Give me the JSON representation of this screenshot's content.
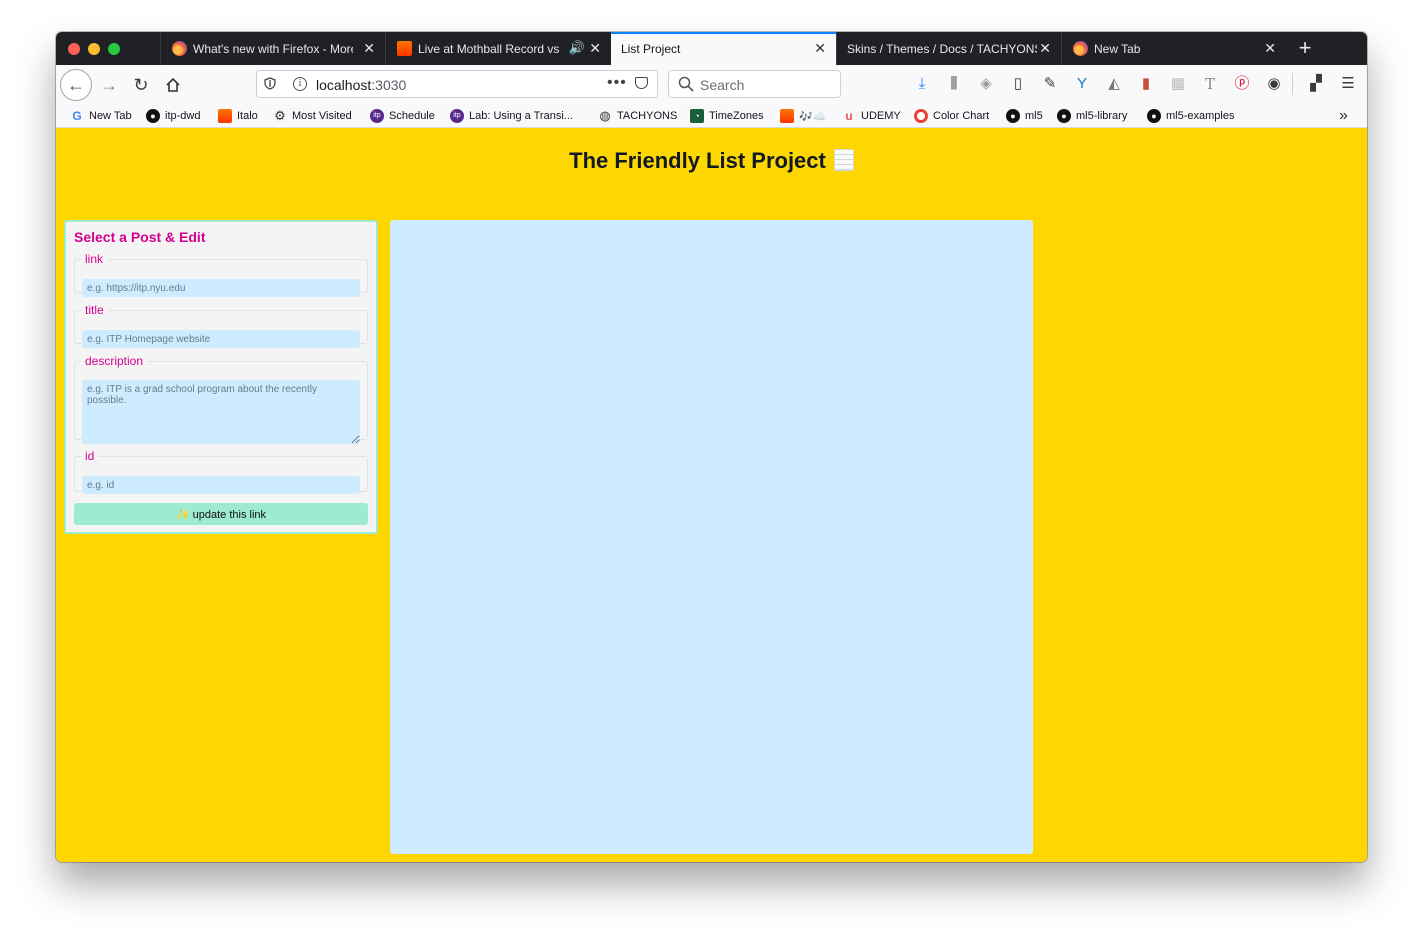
{
  "browser": {
    "tabs": [
      {
        "label": "What's new with Firefox - More",
        "icon": "firefox-icon"
      },
      {
        "label": "Live at Mothball Record vs D",
        "icon": "soundcloud-icon",
        "audio": "speaker-icon"
      },
      {
        "label": "List Project",
        "icon": ""
      },
      {
        "label": "Skins / Themes / Docs / TACHYONS",
        "icon": ""
      },
      {
        "label": "New Tab",
        "icon": "firefox-icon"
      }
    ],
    "close_glyph": "✕",
    "new_tab_glyph": "+",
    "url": {
      "host": "localhost",
      "port": ":3030"
    },
    "url_more": "•••",
    "search_placeholder": "Search",
    "bookmarks_overflow": "»",
    "bookmarks": [
      {
        "label": "New Tab",
        "icon": "google-icon"
      },
      {
        "label": "itp-dwd",
        "icon": "github-icon"
      },
      {
        "label": "Italo",
        "icon": "soundcloud-icon"
      },
      {
        "label": "Most Visited",
        "icon": "gear-icon"
      },
      {
        "label": "Schedule",
        "icon": "itp-icon"
      },
      {
        "label": "Lab: Using a Transi...",
        "icon": "itp-icon"
      },
      {
        "label": "TACHYONS",
        "icon": "globe-icon"
      },
      {
        "label": "TimeZones",
        "icon": "timezones-icon"
      },
      {
        "label": "🎶☁️",
        "icon": "soundcloud-icon"
      },
      {
        "label": "UDEMY",
        "icon": "udemy-icon"
      },
      {
        "label": "Color Chart",
        "icon": "color-chart-icon"
      },
      {
        "label": "ml5",
        "icon": "github-icon"
      },
      {
        "label": "ml5-library",
        "icon": "github-icon"
      },
      {
        "label": "ml5-examples",
        "icon": "github-icon"
      }
    ]
  },
  "page": {
    "title": "The Friendly List Project",
    "panel": {
      "heading": "Select a Post & Edit",
      "fields": {
        "link": {
          "label": "link",
          "placeholder": "e.g. https://itp.nyu.edu"
        },
        "title": {
          "label": "title",
          "placeholder": "e.g. ITP Homepage website"
        },
        "description": {
          "label": "description",
          "placeholder": "e.g. ITP is a grad school program about the recently possible."
        },
        "id": {
          "label": "id",
          "placeholder": "e.g. id"
        }
      },
      "update_button": {
        "icon": "✨",
        "label": "update this link"
      }
    }
  },
  "colors": {
    "page_background": "#ffd700",
    "panel_accent": "#d5008f",
    "button": "#9eebcf",
    "list_area": "#cdecff"
  }
}
